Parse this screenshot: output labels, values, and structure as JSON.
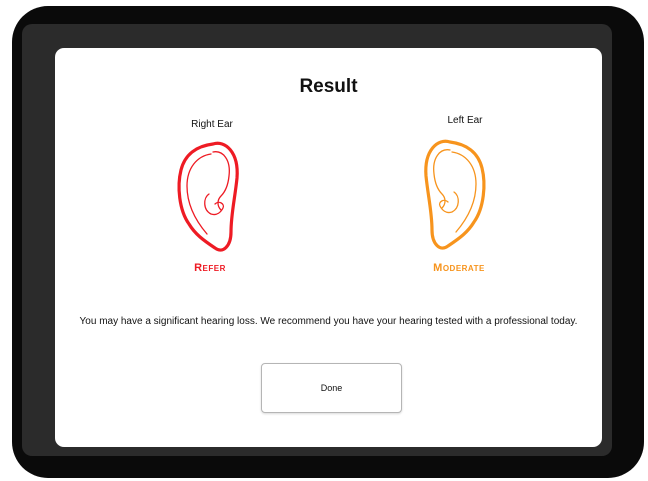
{
  "result": {
    "title": "Result",
    "right_ear": {
      "label": "Right Ear",
      "status": "Refer",
      "color": "#ee1b24",
      "icon": "right-ear-icon"
    },
    "left_ear": {
      "label": "Left Ear",
      "status": "Moderate",
      "color": "#f7941d",
      "icon": "left-ear-icon"
    },
    "message": "You may have a significant hearing loss. We recommend you have your hearing tested with a professional today.",
    "done_label": "Done"
  }
}
